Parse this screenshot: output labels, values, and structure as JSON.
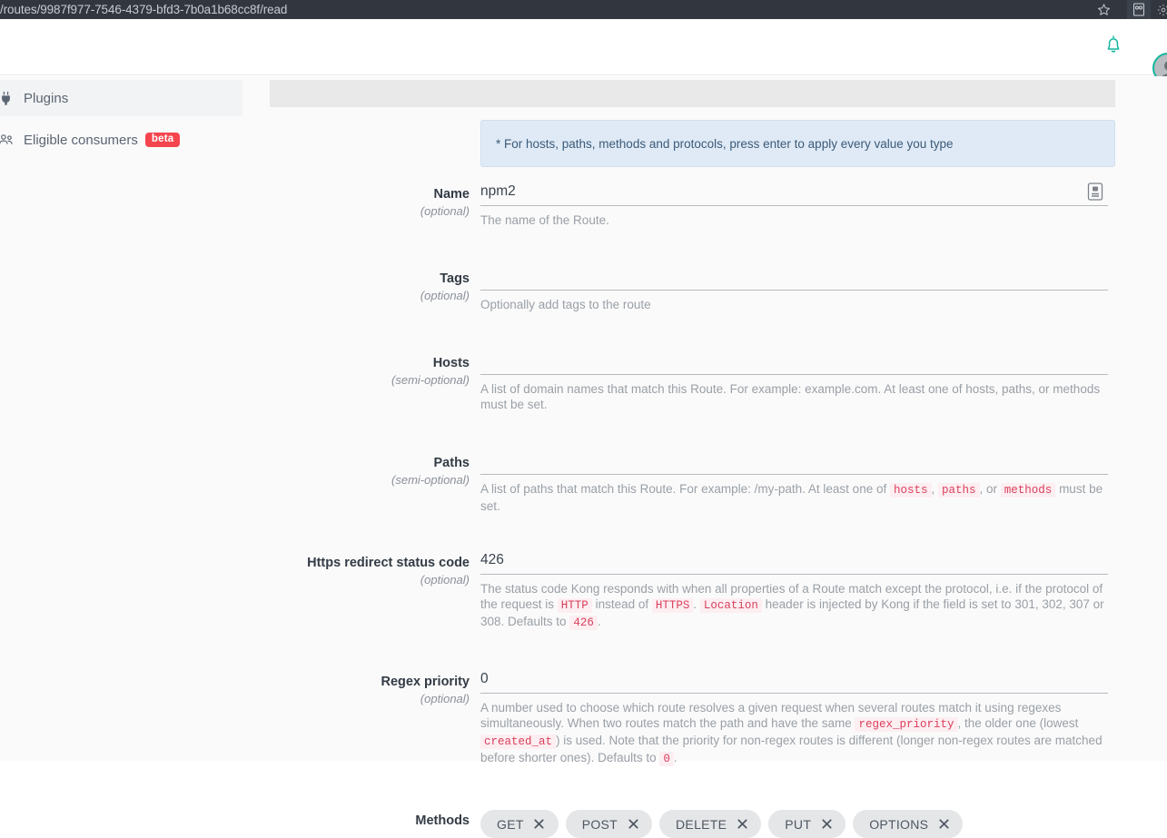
{
  "browser": {
    "url": "/routes/9987f977-7546-4379-bfd3-7b0a1b68cc8f/read",
    "icons": {
      "bookmark": "star-icon",
      "reader": "reader-mode-icon",
      "extension": "extension-icon"
    }
  },
  "header": {
    "notifications_icon": "bell-icon",
    "avatar_icon": "user-avatar",
    "accent_color": "#15b79e"
  },
  "sidebar": {
    "items": [
      {
        "label": "Plugins",
        "icon": "plug-icon",
        "active": true,
        "badge": null
      },
      {
        "label": "Eligible consumers",
        "icon": "users-icon",
        "active": false,
        "badge": "beta"
      }
    ],
    "badge_color": "#f4454e"
  },
  "content": {
    "info_banner": {
      "text": "* For hosts, paths, methods and protocols, press enter to apply every value you type",
      "bg_color": "#dfeaf6",
      "text_color": "#3c5a78"
    }
  },
  "form": {
    "fields": [
      {
        "label": "Name",
        "optional": "(optional)",
        "value": "npm2",
        "placeholder": "",
        "help": [
          {
            "t": "text",
            "v": "The name of the Route."
          }
        ],
        "has_autofill_icon": true
      },
      {
        "label": "Tags",
        "optional": "(optional)",
        "value": "",
        "placeholder": "",
        "help": [
          {
            "t": "text",
            "v": "Optionally add tags to the route"
          }
        ],
        "has_autofill_icon": false
      },
      {
        "label": "Hosts",
        "optional": "(semi-optional)",
        "value": "",
        "placeholder": "",
        "help": [
          {
            "t": "text",
            "v": "A list of domain names that match this Route. For example: example.com. At least one of hosts, paths, or methods must be set."
          }
        ],
        "has_autofill_icon": false
      },
      {
        "label": "Paths",
        "optional": "(semi-optional)",
        "value": "",
        "placeholder": "",
        "help": [
          {
            "t": "text",
            "v": "A list of paths that match this Route. For example: /my-path. At least one of "
          },
          {
            "t": "code",
            "v": "hosts"
          },
          {
            "t": "text",
            "v": ", "
          },
          {
            "t": "code",
            "v": "paths"
          },
          {
            "t": "text",
            "v": ", or "
          },
          {
            "t": "code",
            "v": "methods"
          },
          {
            "t": "text",
            "v": " must be set."
          }
        ],
        "has_autofill_icon": false
      },
      {
        "label": "Https redirect status code",
        "optional": "(optional)",
        "value": "426",
        "placeholder": "",
        "help": [
          {
            "t": "text",
            "v": "The status code Kong responds with when all properties of a Route match except the protocol, i.e. if the protocol of the request is "
          },
          {
            "t": "code",
            "v": "HTTP"
          },
          {
            "t": "text",
            "v": " instead of "
          },
          {
            "t": "code",
            "v": "HTTPS"
          },
          {
            "t": "text",
            "v": ". "
          },
          {
            "t": "code",
            "v": "Location"
          },
          {
            "t": "text",
            "v": " header is injected by Kong if the field is set to 301, 302, 307 or 308. Defaults to "
          },
          {
            "t": "code",
            "v": "426"
          },
          {
            "t": "text",
            "v": "."
          }
        ],
        "has_autofill_icon": false
      },
      {
        "label": "Regex priority",
        "optional": "(optional)",
        "value": "0",
        "placeholder": "",
        "help": [
          {
            "t": "text",
            "v": "A number used to choose which route resolves a given request when several routes match it using regexes simultaneously. When two routes match the path and have the same "
          },
          {
            "t": "code",
            "v": "regex_priority"
          },
          {
            "t": "text",
            "v": ", the older one (lowest "
          },
          {
            "t": "code",
            "v": "created_at"
          },
          {
            "t": "text",
            "v": ") is used. Note that the priority for non-regex routes is different (longer non-regex routes are matched before shorter ones). Defaults to "
          },
          {
            "t": "code",
            "v": "0"
          },
          {
            "t": "text",
            "v": "."
          }
        ],
        "has_autofill_icon": false
      }
    ],
    "methods_field": {
      "label": "Methods",
      "optional": "",
      "chips": [
        "GET",
        "POST",
        "DELETE",
        "PUT",
        "OPTIONS"
      ]
    }
  }
}
